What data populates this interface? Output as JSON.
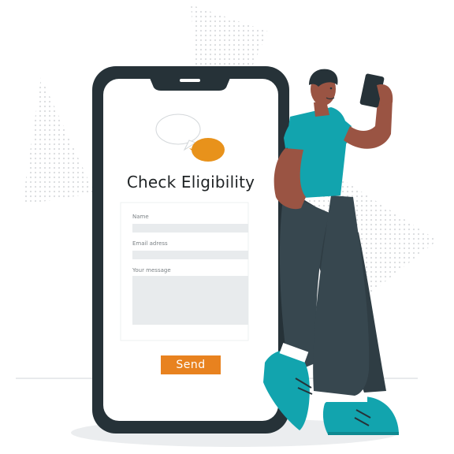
{
  "form": {
    "title": "Check Eligibility",
    "name_label": "Name",
    "email_label": "Email adress",
    "message_label": "Your message",
    "name_value": "",
    "email_value": "",
    "message_value": "",
    "send_label": "Send"
  },
  "colors": {
    "phone_frame": "#263238",
    "screen": "#ffffff",
    "field": "#e8ebed",
    "accent_orange": "#e8821f",
    "shirt": "#12a4ae",
    "pants": "#37474f",
    "skin": "#9a5443",
    "dots": "#d9dcde"
  },
  "icons": {
    "speech_bubbles": "speech-bubbles-icon"
  }
}
